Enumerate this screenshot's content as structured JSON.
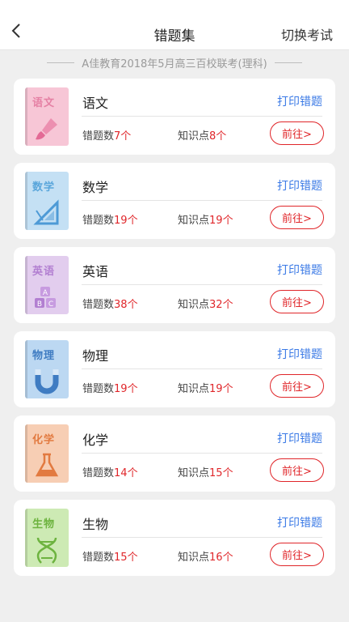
{
  "header": {
    "title": "错题集",
    "switch_label": "切换考试"
  },
  "exam_name": "A佳教育2018年5月高三百校联考(理科)",
  "labels": {
    "wrong_prefix": "错题数",
    "knowledge_prefix": "知识点",
    "unit": "个",
    "print": "打印错题",
    "goto": "前往>"
  },
  "subjects": [
    {
      "name": "语文",
      "cover_text": "语文",
      "cover_color": "#f7c6d6",
      "text_color": "#e580a4",
      "icon": "brush-icon",
      "wrong": "7",
      "knowledge": "8"
    },
    {
      "name": "数学",
      "cover_text": "数学",
      "cover_color": "#c4e0f4",
      "text_color": "#5aa6db",
      "icon": "ruler-icon",
      "wrong": "19",
      "knowledge": "19"
    },
    {
      "name": "英语",
      "cover_text": "英语",
      "cover_color": "#e2cdee",
      "text_color": "#b27fd1",
      "icon": "abc-blocks-icon",
      "wrong": "38",
      "knowledge": "32"
    },
    {
      "name": "物理",
      "cover_text": "物理",
      "cover_color": "#bcd8f2",
      "text_color": "#3f7cc2",
      "icon": "magnet-icon",
      "wrong": "19",
      "knowledge": "19"
    },
    {
      "name": "化学",
      "cover_text": "化学",
      "cover_color": "#f7ceb4",
      "text_color": "#e27a40",
      "icon": "flask-icon",
      "wrong": "14",
      "knowledge": "15"
    },
    {
      "name": "生物",
      "cover_text": "生物",
      "cover_color": "#cdeab4",
      "text_color": "#6db33f",
      "icon": "dna-icon",
      "wrong": "15",
      "knowledge": "16"
    }
  ]
}
